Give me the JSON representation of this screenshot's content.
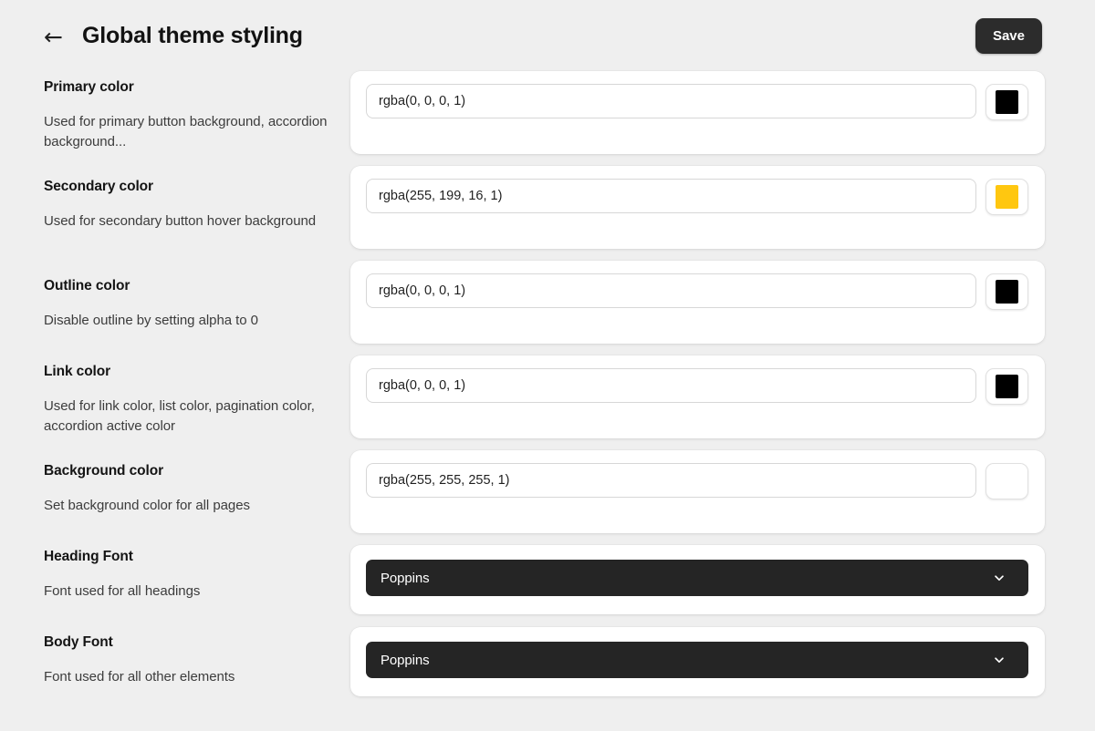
{
  "header": {
    "back_icon": "arrow-left-icon",
    "back_glyph": "←",
    "title": "Global theme styling",
    "save_label": "Save",
    "save_bg": "#2c2c2c"
  },
  "page": {
    "background": "#efefef",
    "card_background": "#ffffff"
  },
  "settings": [
    {
      "key": "primary_color",
      "label": "Primary color",
      "description": "Used for primary button background, accordion background...",
      "type": "color",
      "value": "rgba(0, 0, 0, 1)",
      "swatch": "#000000"
    },
    {
      "key": "secondary_color",
      "label": "Secondary color",
      "description": "Used for secondary button hover background",
      "type": "color",
      "value": "rgba(255, 199, 16, 1)",
      "swatch": "#ffc710"
    },
    {
      "key": "outline_color",
      "label": "Outline color",
      "description": "Disable outline by setting alpha to 0",
      "type": "color",
      "value": "rgba(0, 0, 0, 1)",
      "swatch": "#000000"
    },
    {
      "key": "link_color",
      "label": "Link color",
      "description": "Used for link color, list color, pagination color, accordion active color",
      "type": "color",
      "value": "rgba(0, 0, 0, 1)",
      "swatch": "#000000"
    },
    {
      "key": "background_color",
      "label": "Background color",
      "description": "Set background color for all pages",
      "type": "color",
      "value": "rgba(255, 255, 255, 1)",
      "swatch": "#ffffff"
    },
    {
      "key": "heading_font",
      "label": "Heading Font",
      "description": "Font used for all headings",
      "type": "select",
      "value": "Poppins",
      "chevron_icon": "chevron-down-icon"
    },
    {
      "key": "body_font",
      "label": "Body Font",
      "description": "Font used for all other elements",
      "type": "select",
      "value": "Poppins",
      "chevron_icon": "chevron-down-icon"
    }
  ]
}
